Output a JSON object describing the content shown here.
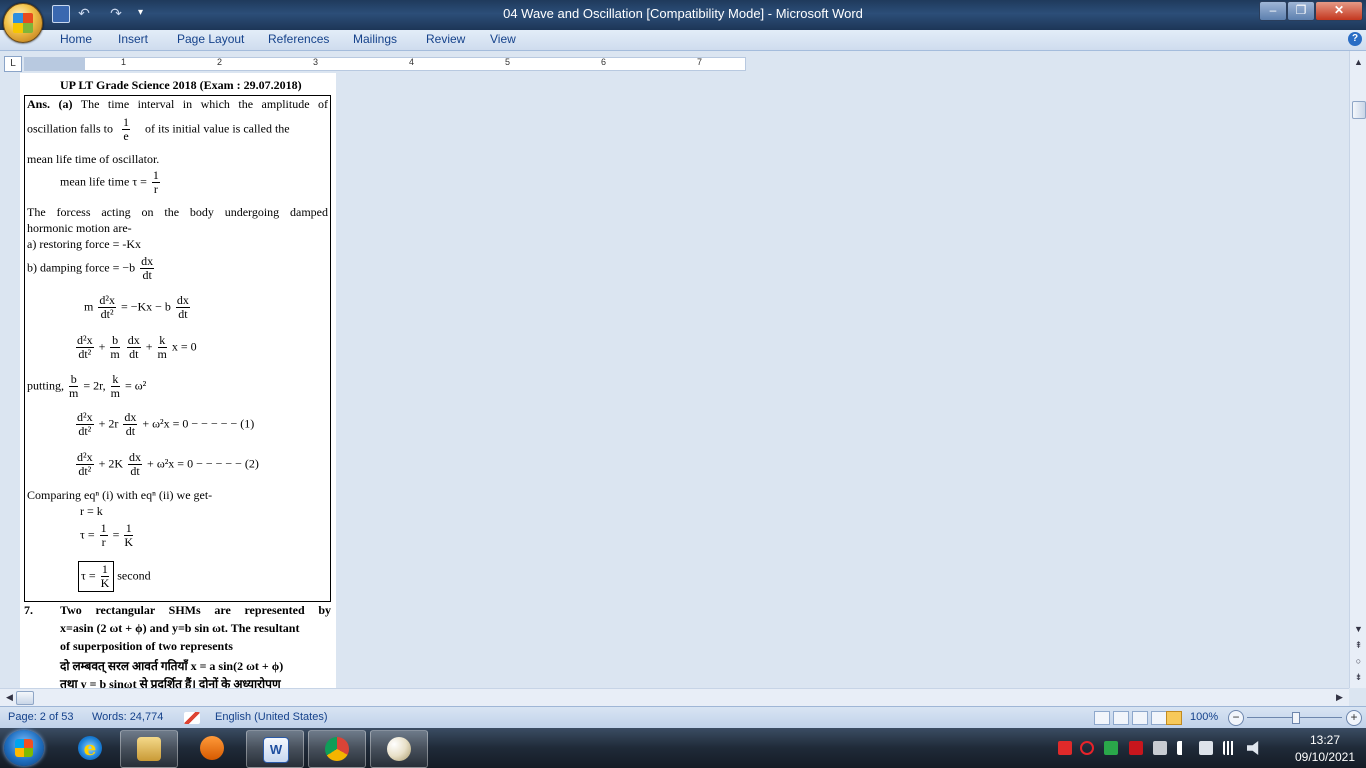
{
  "window": {
    "title": "04 Wave and Oscillation [Compatibility Mode] - Microsoft Word",
    "qat": {
      "undo_glyph": "↶",
      "redo_glyph": "↷",
      "more_glyph": "▾"
    },
    "controls": {
      "minimize": "–",
      "maximize": "❐",
      "close": "✕"
    }
  },
  "ribbon": {
    "tabs": [
      "Home",
      "Insert",
      "Page Layout",
      "References",
      "Mailings",
      "Review",
      "View"
    ],
    "help": "?"
  },
  "ruler": {
    "tab_selector": "L",
    "numbers": [
      "1",
      "2",
      "3",
      "4",
      "5",
      "6",
      "7"
    ]
  },
  "document": {
    "heading": "UP LT Grade Science 2018 (Exam : 29.07.2018)",
    "ans_label": "Ans. (a)",
    "ans_line1_rest": "The time interval in which the amplitude of",
    "ans_line2_a": "oscillation falls to",
    "ans_line2_b": "of its initial value is called the",
    "frac_1_over_e": {
      "num": "1",
      "den": "e"
    },
    "ans_line3": "mean life time of oscillator.",
    "mean_life_label": "mean life time",
    "tau_eq": "τ =",
    "frac_1_over_r": {
      "num": "1",
      "den": "r"
    },
    "force_line1": "The forcess acting on the body undergoing damped",
    "force_line2": "hormonic motion are-",
    "force_a": "a) restoring force = -Kx",
    "force_b": "b) damping force = −b",
    "frac_dx_dt": {
      "num": "dx",
      "den": "dt"
    },
    "frac_d2x_dt2": {
      "num": "d²x",
      "den": "dt²"
    },
    "eq1_m": "m",
    "eq1_mid": "= −Kx − b",
    "eq2_plus1": "+",
    "frac_b_m": {
      "num": "b",
      "den": "m"
    },
    "eq2_plus2": "+",
    "frac_k_m": {
      "num": "k",
      "den": "m"
    },
    "eq2_tail": "x  = 0",
    "putting": "putting,",
    "putting_mid": "= 2r,",
    "putting_tail": "= ω²",
    "eq3_mid": "+ 2r",
    "eq3_tail": "+ ω²x  = 0 − − − − − (1)",
    "eq4_mid": "+ 2K",
    "eq4_tail": "+ ω²x  = 0 − − − − − (2)",
    "compare": "Comparing eqⁿ (i) with eqⁿ (ii) we get-",
    "r_eq_k": "r = k",
    "tau_line_mid": "=",
    "frac_1_over_K": {
      "num": "1",
      "den": "K"
    },
    "tau_final_label": "τ =",
    "second": "second",
    "q7_num": "7.",
    "q7_line1": "Two rectangular SHMs are represented by",
    "q7_line2": "x=asin (2  ωt + ϕ)  and y=b sin ωt. The resultant",
    "q7_line3": "of superposition of two represents",
    "q7_hindi1": "दो लम्बवत् सरल आवर्त गतियाँ  x = a sin(2  ωt + ϕ)",
    "q7_hindi2": "तथा  y = b sinωt  से प्रदर्शित हैं। दोनों के अध्यारोपण"
  },
  "scrollbars": {
    "up": "▲",
    "down": "▼",
    "left": "◀",
    "right": "▶",
    "prev_page": "⇞",
    "select_browse": "○",
    "next_page": "⇟"
  },
  "statusbar": {
    "page": "Page: 2 of 53",
    "words": "Words: 24,774",
    "language": "English (United States)",
    "zoom": "100%",
    "zoom_minus": "−",
    "zoom_plus": "+",
    "zoom_level": 1.0
  },
  "taskbar": {
    "clock_time": "13:27",
    "clock_date": "09/10/2021",
    "pinned": [
      "start-icon",
      "internet-explorer-icon",
      "file-explorer-icon",
      "media-player-icon",
      "word-icon",
      "chrome-icon",
      "paint-icon"
    ],
    "tray": [
      "anydesk-icon",
      "opera-icon",
      "q-app-icon",
      "pdf-icon",
      "desktop-icon",
      "action-center-flag-icon",
      "network-icon",
      "signal-icon",
      "volume-icon"
    ]
  },
  "colors": {
    "titlebar": "#1f3a5c",
    "ribbon_text": "#15428b",
    "doc_background": "#dbe5f1",
    "taskbar": "#1f2a38"
  }
}
